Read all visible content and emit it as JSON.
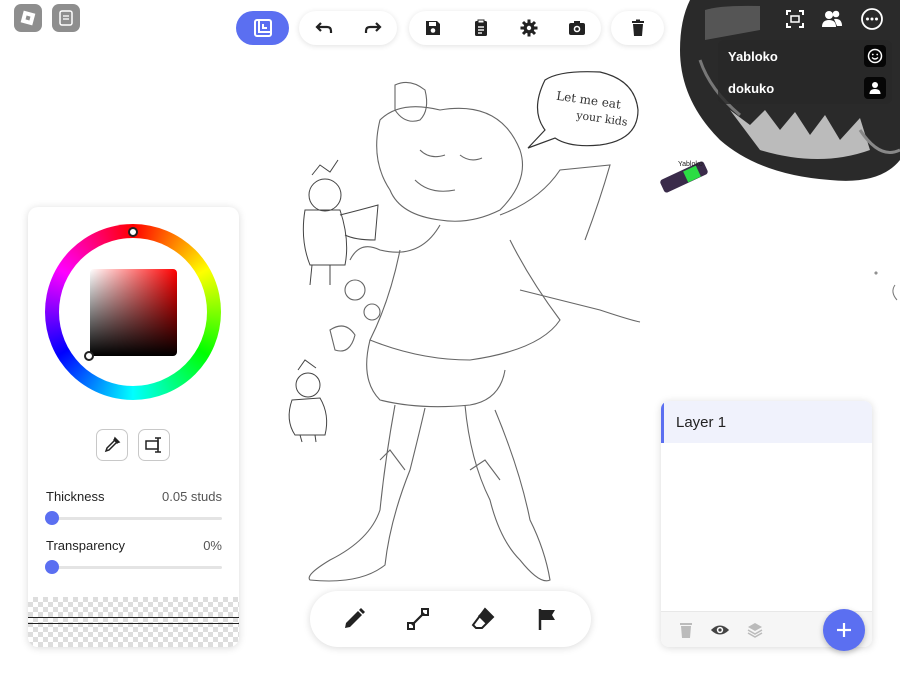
{
  "toolbar": {
    "home_icon": "grid-square-icon",
    "buttons": [
      "undo-icon",
      "redo-icon",
      "save-icon",
      "clipboard-icon",
      "gear-icon",
      "camera-icon",
      "trash-icon"
    ]
  },
  "canvas": {
    "speech_text_line1": "Let me eat",
    "speech_text_line2": "your kids",
    "other_user_tag": "Yabloko"
  },
  "players": [
    {
      "name": "Yabloko",
      "icon": "smiley-icon"
    },
    {
      "name": "dokuko",
      "icon": "person-icon"
    }
  ],
  "color_panel": {
    "thickness_label": "Thickness",
    "thickness_value": "0.05 studs",
    "thickness_level": 0,
    "transparency_label": "Transparency",
    "transparency_value": "0%",
    "transparency_level": 0,
    "eyedropper_icon": "eyedropper-icon",
    "shape_icon": "shape-input-icon"
  },
  "tools": [
    "pencil-icon",
    "line-icon",
    "eraser-icon",
    "flag-icon"
  ],
  "layers": {
    "items": [
      {
        "label": "Layer 1"
      }
    ],
    "footer_icons": [
      "trash-icon",
      "eye-icon",
      "layers-icon"
    ],
    "add_icon": "plus-icon"
  },
  "colors": {
    "accent": "#5b6ff1"
  }
}
